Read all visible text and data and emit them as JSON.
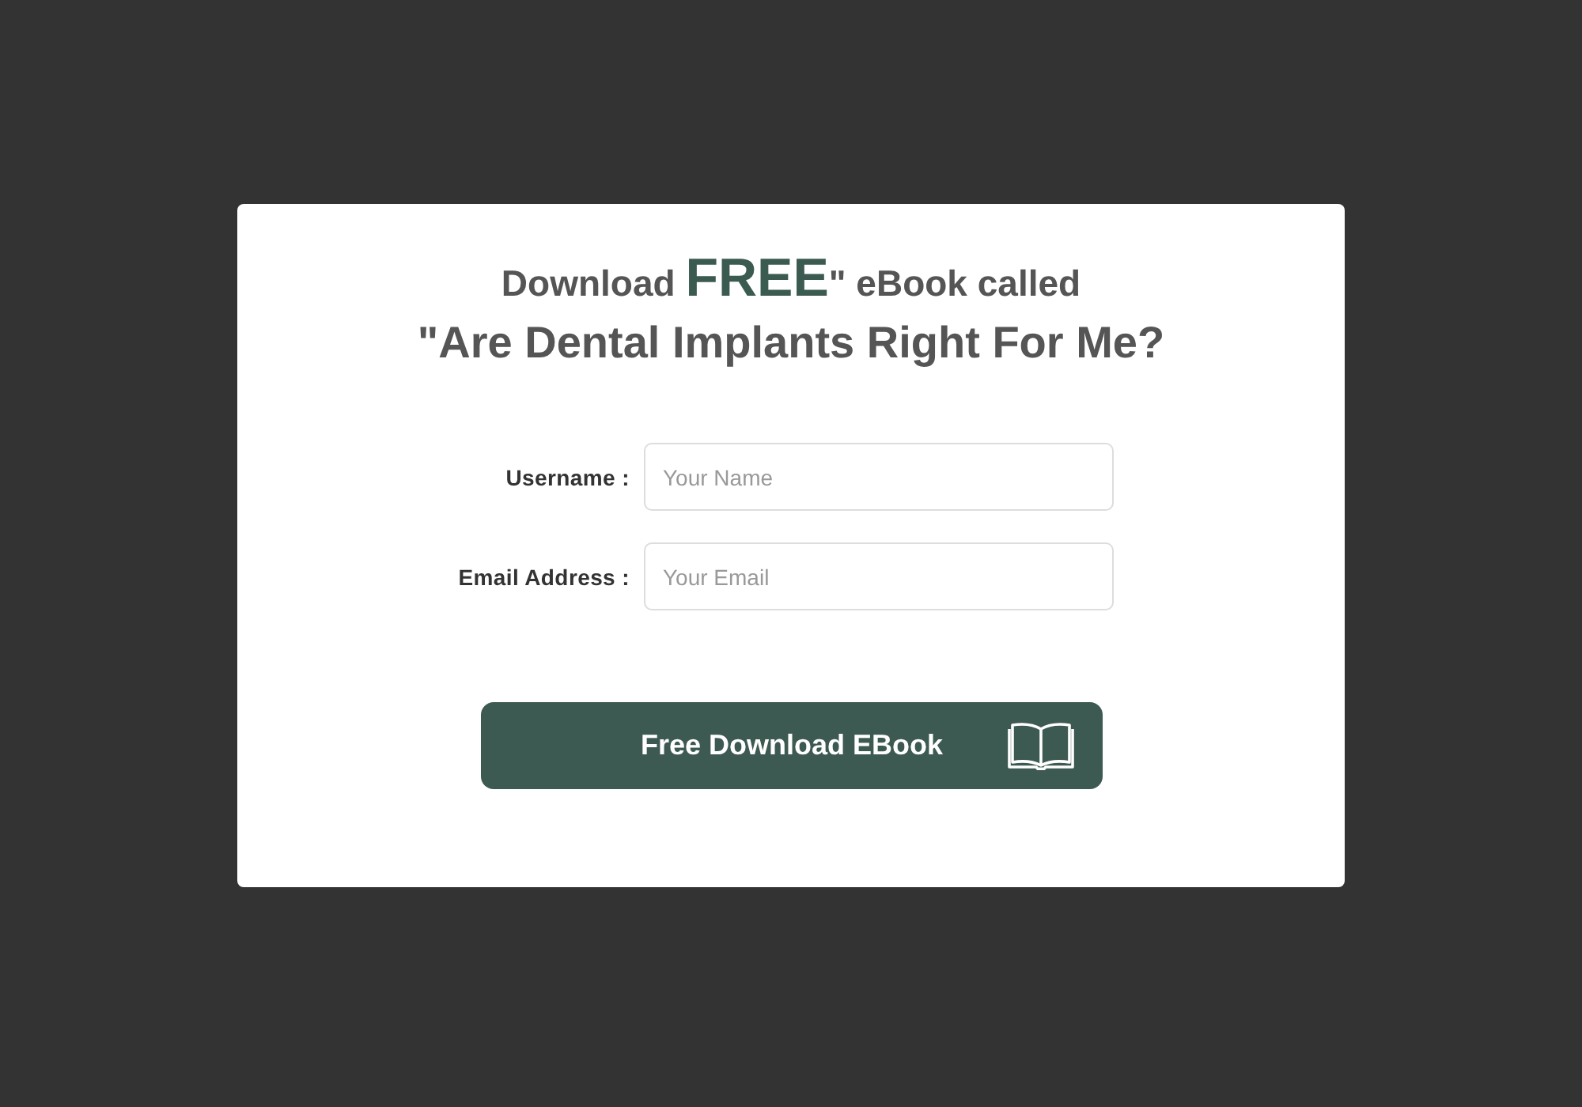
{
  "heading": {
    "line_1": "Download **FREE**\" eBook called",
    "line_2": "\"Are Dental Implants Right For Me?"
  },
  "fields": [
    {
      "label": "Username :",
      "placeholder": "Your Name"
    },
    {
      "label": "Email Address :",
      "placeholder": "Your Email"
    }
  ],
  "button": {
    "label": "Free Download EBook"
  }
}
